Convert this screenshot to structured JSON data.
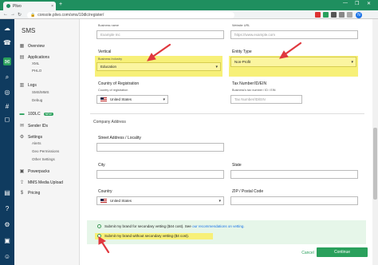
{
  "browser": {
    "tab_title": "Plivo",
    "tab_close": "×",
    "new_tab": "+",
    "url": "console.plivo.com/sms/10dlc/register/",
    "window_controls": [
      "—",
      "❐",
      "✕"
    ],
    "profile_initial": "N"
  },
  "sidebar": {
    "title": "SMS",
    "items": [
      {
        "label": "Overview",
        "icon": "grid-icon"
      },
      {
        "label": "Applications",
        "icon": "apps-icon",
        "sub": [
          "XML",
          "PHLO"
        ]
      },
      {
        "label": "Logs",
        "icon": "logs-icon",
        "sub": [
          "SMS/MMS",
          "Debug"
        ]
      },
      {
        "label": "10DLC",
        "icon": "10dlc-icon",
        "badge": "NEW"
      },
      {
        "label": "Sender IDs",
        "icon": "sender-icon"
      },
      {
        "label": "Settings",
        "icon": "gear-icon",
        "sub": [
          "Alerts",
          "Geo Permissions",
          "Other Settings"
        ]
      },
      {
        "label": "Powerpacks",
        "icon": "powerpack-icon"
      },
      {
        "label": "MMS Media Upload",
        "icon": "upload-icon"
      },
      {
        "label": "Pricing",
        "icon": "pricing-icon"
      }
    ]
  },
  "form": {
    "business_name": {
      "label": "Business name",
      "placeholder": "Example Inc"
    },
    "website_url": {
      "label": "Website URL",
      "placeholder": "https://www.example.com"
    },
    "vertical": {
      "label": "Vertical",
      "sublabel": "Business Industry",
      "value": "Education"
    },
    "entity_type": {
      "label": "Entity Type",
      "value": "Non-Profit"
    },
    "country_registration": {
      "label": "Country of Registration",
      "sublabel": "Country of registration",
      "value": "United States"
    },
    "tax_number": {
      "label": "Tax Number/ID/EIN",
      "sublabel": "Business's tax number / ID / EIN",
      "placeholder": "Tax Number/ID/EIN"
    },
    "company_address_title": "Company Address",
    "street": {
      "label": "Street Address / Locality"
    },
    "city": {
      "label": "City"
    },
    "state": {
      "label": "State"
    },
    "country": {
      "label": "Country",
      "value": "United States"
    },
    "zip": {
      "label": "ZIP / Postal Code"
    },
    "vetting_option_1": "Submit my brand for secondary vetting ($44 cost). See",
    "vetting_option_1_link": "our recommendations on vetting.",
    "vetting_option_2": "Submit my brand without secondary vetting ($4 cost).",
    "cancel": "Cancel",
    "continue": "Continue"
  },
  "colors": {
    "brand_green": "#2aa05c",
    "rail": "#0f3b5f",
    "highlight": "#f7f078",
    "annotation_arrow": "#e0383e"
  }
}
